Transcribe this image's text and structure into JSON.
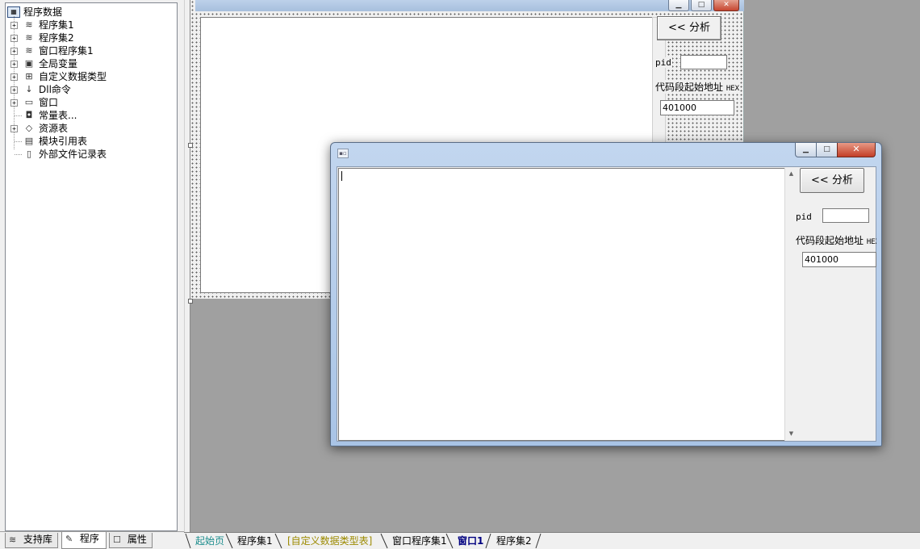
{
  "tree": {
    "root_label": "程序数据",
    "items": [
      {
        "label": "程序集1",
        "icon": "module-icon",
        "glyph": "≋",
        "expandable": true
      },
      {
        "label": "程序集2",
        "icon": "module-icon",
        "glyph": "≋",
        "expandable": true
      },
      {
        "label": "窗口程序集1",
        "icon": "module-icon",
        "glyph": "≋",
        "expandable": true
      },
      {
        "label": "全局变量",
        "icon": "variable-icon",
        "glyph": "▣",
        "expandable": true
      },
      {
        "label": "自定义数据类型",
        "icon": "datatype-icon",
        "glyph": "⊞",
        "expandable": true
      },
      {
        "label": "Dll命令",
        "icon": "dll-icon",
        "glyph": "↓",
        "expandable": true
      },
      {
        "label": "窗口",
        "icon": "window-icon",
        "glyph": "▭",
        "expandable": true
      },
      {
        "label": "常量表...",
        "icon": "constant-icon",
        "glyph": "◘",
        "expandable": false
      },
      {
        "label": "资源表",
        "icon": "resource-icon",
        "glyph": "◇",
        "expandable": true
      },
      {
        "label": "模块引用表",
        "icon": "module-ref-icon",
        "glyph": "▤",
        "expandable": false
      },
      {
        "label": "外部文件记录表",
        "icon": "file-record-icon",
        "glyph": "▯",
        "expandable": false
      }
    ]
  },
  "left_tabs": [
    {
      "label": "支持库",
      "icon": "library-icon",
      "glyph": "≋"
    },
    {
      "label": "程序",
      "icon": "program-icon",
      "glyph": "✎"
    },
    {
      "label": "属性",
      "icon": "properties-icon",
      "glyph": "☐"
    }
  ],
  "design_form": {
    "analyze_label": "<<  分析",
    "pid_label": "pid",
    "addr_label": "代码段起始地址",
    "addr_hex": "HEX",
    "addr_value": "401000"
  },
  "preview_window": {
    "analyze_label": "<<  分析",
    "pid_label": "pid",
    "addr_label": "代码段起始地址",
    "addr_hex": "HEX",
    "addr_value": "401000"
  },
  "doc_tabs": [
    {
      "label": "起始页",
      "style": "start"
    },
    {
      "label": "程序集1",
      "style": "normal"
    },
    {
      "label": "[自定义数据类型表]",
      "style": "bracket"
    },
    {
      "label": "窗口程序集1",
      "style": "normal"
    },
    {
      "label": "窗口1",
      "style": "bold"
    },
    {
      "label": "程序集2",
      "style": "normal"
    }
  ],
  "colors": {
    "workspace_bg": "#a0a0a0",
    "start_tab": "#1a8c8c",
    "bracket_tab": "#9c8a00",
    "active_tab": "#000080"
  }
}
